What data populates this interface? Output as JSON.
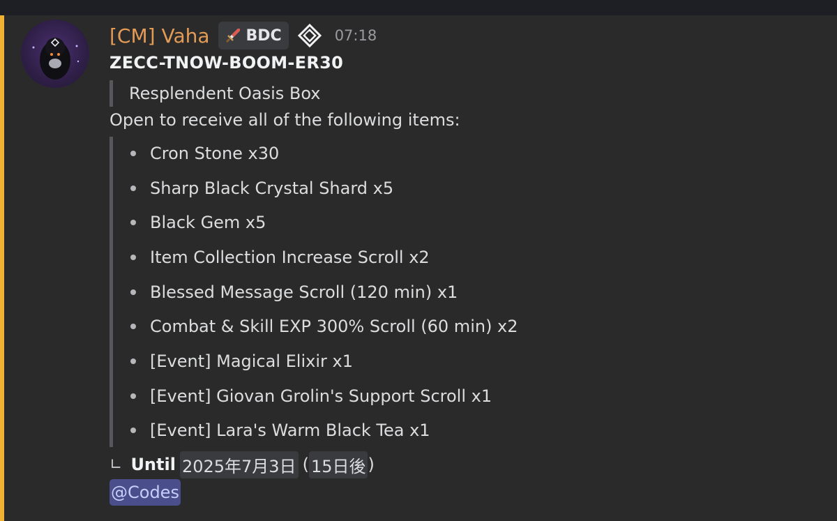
{
  "message": {
    "author": {
      "name": "[CM] Vaha",
      "name_color": "#e39b56",
      "tag_icon": "sword-icon",
      "tag_label": "BDC",
      "role_icon": "diamond-logo-icon"
    },
    "timestamp": "07:18",
    "code": "ZECC-TNOW-BOOM-ER30",
    "box_name": "Resplendent Oasis Box",
    "intro": "Open to receive all of the following items:",
    "items": [
      "Cron Stone x30",
      "Sharp Black Crystal Shard x5",
      "Black Gem x5",
      "Item Collection Increase Scroll x2",
      "Blessed Message Scroll (120 min) x1",
      "Combat & Skill EXP 300% Scroll (60 min) x2",
      "[Event] Magical Elixir x1",
      "[Event] Giovan Grolin's Support Scroll x1",
      "[Event] Lara's Warm Black Tea x1"
    ],
    "until": {
      "corner": "∟",
      "label": "Until",
      "date": "2025年7月3日",
      "relative_open": "(",
      "relative": "15日後",
      "relative_close": ")"
    },
    "mention": "@Codes"
  },
  "colors": {
    "background": "#2b2a2a",
    "accent_bar": "#f0b232",
    "mention_bg": "#4a4e8a"
  }
}
